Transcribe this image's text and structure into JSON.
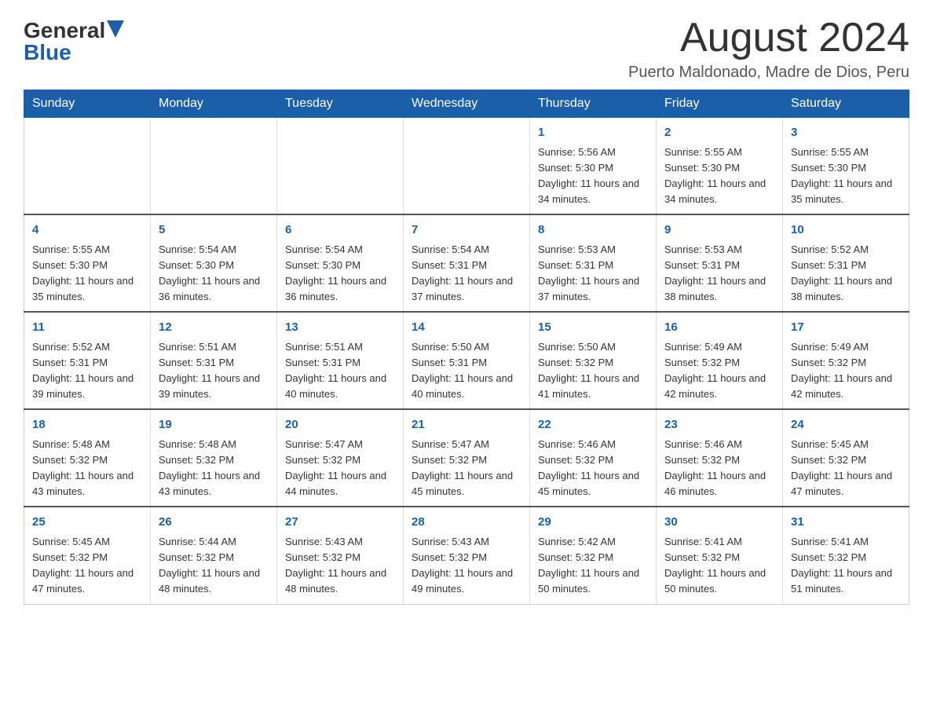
{
  "header": {
    "logo_general": "General",
    "logo_blue": "Blue",
    "month_title": "August 2024",
    "location": "Puerto Maldonado, Madre de Dios, Peru"
  },
  "days_of_week": [
    "Sunday",
    "Monday",
    "Tuesday",
    "Wednesday",
    "Thursday",
    "Friday",
    "Saturday"
  ],
  "weeks": [
    [
      {
        "day": "",
        "info": ""
      },
      {
        "day": "",
        "info": ""
      },
      {
        "day": "",
        "info": ""
      },
      {
        "day": "",
        "info": ""
      },
      {
        "day": "1",
        "info": "Sunrise: 5:56 AM\nSunset: 5:30 PM\nDaylight: 11 hours and 34 minutes."
      },
      {
        "day": "2",
        "info": "Sunrise: 5:55 AM\nSunset: 5:30 PM\nDaylight: 11 hours and 34 minutes."
      },
      {
        "day": "3",
        "info": "Sunrise: 5:55 AM\nSunset: 5:30 PM\nDaylight: 11 hours and 35 minutes."
      }
    ],
    [
      {
        "day": "4",
        "info": "Sunrise: 5:55 AM\nSunset: 5:30 PM\nDaylight: 11 hours and 35 minutes."
      },
      {
        "day": "5",
        "info": "Sunrise: 5:54 AM\nSunset: 5:30 PM\nDaylight: 11 hours and 36 minutes."
      },
      {
        "day": "6",
        "info": "Sunrise: 5:54 AM\nSunset: 5:30 PM\nDaylight: 11 hours and 36 minutes."
      },
      {
        "day": "7",
        "info": "Sunrise: 5:54 AM\nSunset: 5:31 PM\nDaylight: 11 hours and 37 minutes."
      },
      {
        "day": "8",
        "info": "Sunrise: 5:53 AM\nSunset: 5:31 PM\nDaylight: 11 hours and 37 minutes."
      },
      {
        "day": "9",
        "info": "Sunrise: 5:53 AM\nSunset: 5:31 PM\nDaylight: 11 hours and 38 minutes."
      },
      {
        "day": "10",
        "info": "Sunrise: 5:52 AM\nSunset: 5:31 PM\nDaylight: 11 hours and 38 minutes."
      }
    ],
    [
      {
        "day": "11",
        "info": "Sunrise: 5:52 AM\nSunset: 5:31 PM\nDaylight: 11 hours and 39 minutes."
      },
      {
        "day": "12",
        "info": "Sunrise: 5:51 AM\nSunset: 5:31 PM\nDaylight: 11 hours and 39 minutes."
      },
      {
        "day": "13",
        "info": "Sunrise: 5:51 AM\nSunset: 5:31 PM\nDaylight: 11 hours and 40 minutes."
      },
      {
        "day": "14",
        "info": "Sunrise: 5:50 AM\nSunset: 5:31 PM\nDaylight: 11 hours and 40 minutes."
      },
      {
        "day": "15",
        "info": "Sunrise: 5:50 AM\nSunset: 5:32 PM\nDaylight: 11 hours and 41 minutes."
      },
      {
        "day": "16",
        "info": "Sunrise: 5:49 AM\nSunset: 5:32 PM\nDaylight: 11 hours and 42 minutes."
      },
      {
        "day": "17",
        "info": "Sunrise: 5:49 AM\nSunset: 5:32 PM\nDaylight: 11 hours and 42 minutes."
      }
    ],
    [
      {
        "day": "18",
        "info": "Sunrise: 5:48 AM\nSunset: 5:32 PM\nDaylight: 11 hours and 43 minutes."
      },
      {
        "day": "19",
        "info": "Sunrise: 5:48 AM\nSunset: 5:32 PM\nDaylight: 11 hours and 43 minutes."
      },
      {
        "day": "20",
        "info": "Sunrise: 5:47 AM\nSunset: 5:32 PM\nDaylight: 11 hours and 44 minutes."
      },
      {
        "day": "21",
        "info": "Sunrise: 5:47 AM\nSunset: 5:32 PM\nDaylight: 11 hours and 45 minutes."
      },
      {
        "day": "22",
        "info": "Sunrise: 5:46 AM\nSunset: 5:32 PM\nDaylight: 11 hours and 45 minutes."
      },
      {
        "day": "23",
        "info": "Sunrise: 5:46 AM\nSunset: 5:32 PM\nDaylight: 11 hours and 46 minutes."
      },
      {
        "day": "24",
        "info": "Sunrise: 5:45 AM\nSunset: 5:32 PM\nDaylight: 11 hours and 47 minutes."
      }
    ],
    [
      {
        "day": "25",
        "info": "Sunrise: 5:45 AM\nSunset: 5:32 PM\nDaylight: 11 hours and 47 minutes."
      },
      {
        "day": "26",
        "info": "Sunrise: 5:44 AM\nSunset: 5:32 PM\nDaylight: 11 hours and 48 minutes."
      },
      {
        "day": "27",
        "info": "Sunrise: 5:43 AM\nSunset: 5:32 PM\nDaylight: 11 hours and 48 minutes."
      },
      {
        "day": "28",
        "info": "Sunrise: 5:43 AM\nSunset: 5:32 PM\nDaylight: 11 hours and 49 minutes."
      },
      {
        "day": "29",
        "info": "Sunrise: 5:42 AM\nSunset: 5:32 PM\nDaylight: 11 hours and 50 minutes."
      },
      {
        "day": "30",
        "info": "Sunrise: 5:41 AM\nSunset: 5:32 PM\nDaylight: 11 hours and 50 minutes."
      },
      {
        "day": "31",
        "info": "Sunrise: 5:41 AM\nSunset: 5:32 PM\nDaylight: 11 hours and 51 minutes."
      }
    ]
  ]
}
